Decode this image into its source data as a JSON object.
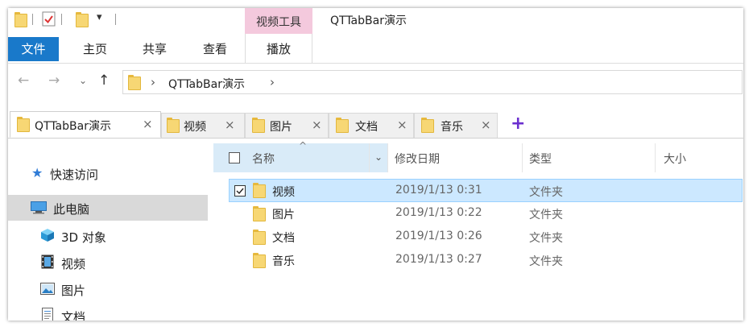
{
  "window": {
    "title": "QTTabBar演示",
    "context_tab_group": "视频工具",
    "colors": {
      "file_tab": "#1979ca",
      "context_tab": "#f4c9dd",
      "selection": "#cce8ff",
      "accent_plus": "#6b2fcf"
    }
  },
  "quick_access_toolbar": [
    "folder-icon",
    "properties-icon",
    "new-folder-icon",
    "customize-dropdown"
  ],
  "ribbon": {
    "tabs": [
      "文件",
      "主页",
      "共享",
      "查看",
      "播放"
    ]
  },
  "address_bar": {
    "path": "QTTabBar演示",
    "separator": "›"
  },
  "qt_tabs": {
    "items": [
      {
        "label": "QTTabBar演示",
        "active": true
      },
      {
        "label": "视频",
        "active": false
      },
      {
        "label": "图片",
        "active": false
      },
      {
        "label": "文档",
        "active": false
      },
      {
        "label": "音乐",
        "active": false
      }
    ],
    "add": "+",
    "close": "×"
  },
  "nav_pane": {
    "items": [
      {
        "label": "快速访问",
        "icon": "star-icon"
      },
      {
        "label": "此电脑",
        "icon": "computer-icon",
        "selected": true
      },
      {
        "label": "3D 对象",
        "icon": "3d-objects-icon"
      },
      {
        "label": "视频",
        "icon": "video-icon"
      },
      {
        "label": "图片",
        "icon": "picture-icon"
      },
      {
        "label": "文档",
        "icon": "document-icon"
      }
    ]
  },
  "file_list": {
    "columns": [
      "名称",
      "修改日期",
      "类型",
      "大小"
    ],
    "rows": [
      {
        "name": "视频",
        "modified": "2019/1/13 0:31",
        "type": "文件夹",
        "selected": true
      },
      {
        "name": "图片",
        "modified": "2019/1/13 0:22",
        "type": "文件夹"
      },
      {
        "name": "文档",
        "modified": "2019/1/13 0:26",
        "type": "文件夹"
      },
      {
        "name": "音乐",
        "modified": "2019/1/13 0:27",
        "type": "文件夹"
      }
    ]
  }
}
